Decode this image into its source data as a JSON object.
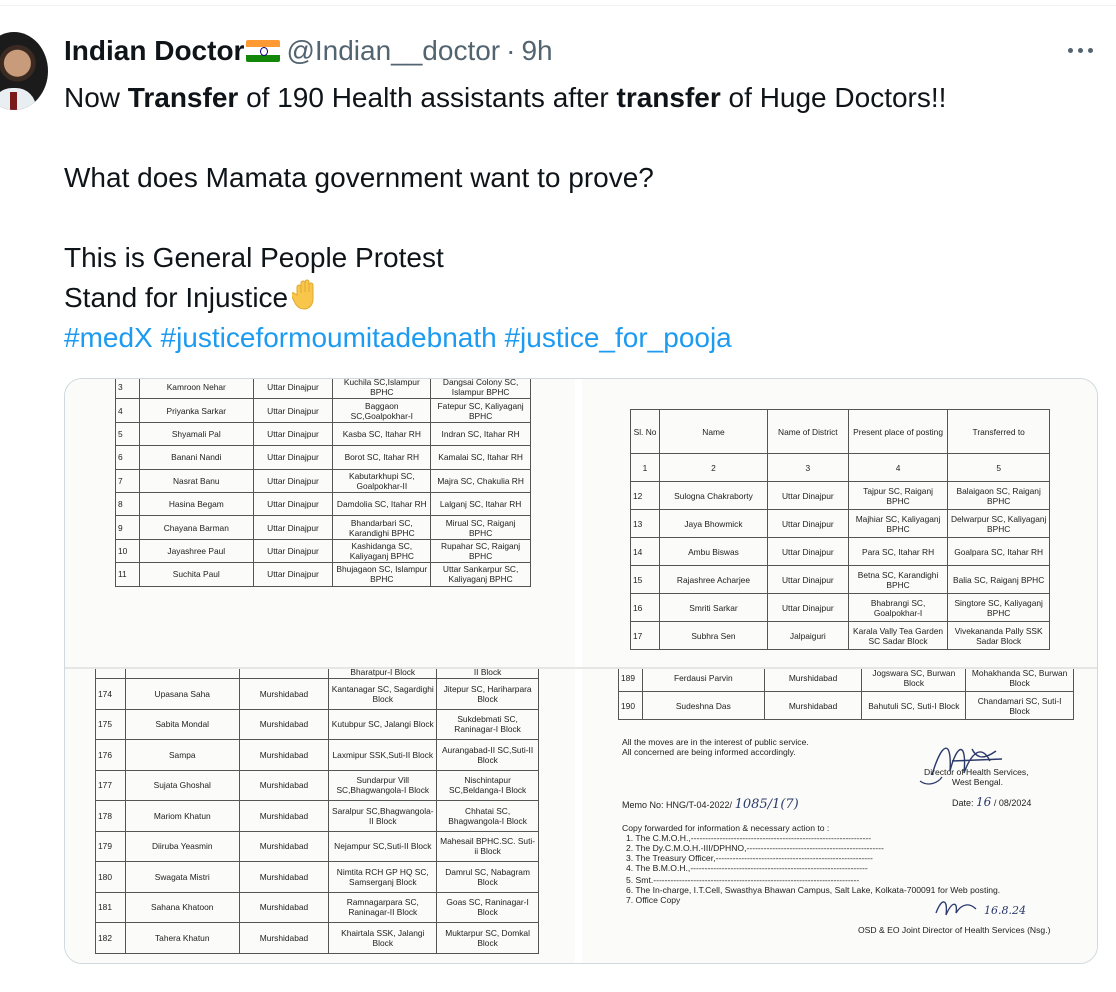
{
  "author": {
    "display_name": "Indian Doctor",
    "handle": "@Indian__doctor",
    "separator": "·",
    "time": "9h"
  },
  "icons": {
    "flag": "india-flag-icon",
    "more": "more-horizontal-icon",
    "hand": "raised-hand-icon"
  },
  "tweet": {
    "line1": {
      "a": "Now ",
      "b": "Transfer",
      "c": " of 190 Health  assistants after ",
      "d": "transfer",
      "e": " of Huge Doctors!!"
    },
    "line2": "What does Mamata government want to prove?",
    "line3": "This is General People Protest",
    "line4": "Stand for Injustice",
    "hashtags": [
      "#medX",
      "#justiceformoumitadebnath",
      "#justice_for_pooja"
    ]
  },
  "colors": {
    "link": "#1d9bf0",
    "text": "#0f1419",
    "muted": "#536471",
    "border": "#cfd9de"
  },
  "doc_top_left": {
    "rows": [
      [
        "3",
        "Kamroon Nehar",
        "Uttar Dinajpur",
        "Kuchila SC,Islampur BPHC",
        "Dangsai Colony SC, Islampur BPHC"
      ],
      [
        "4",
        "Priyanka Sarkar",
        "Uttar Dinajpur",
        "Baggaon SC,Goalpokhar-I",
        "Fatepur SC, Kaliyaganj BPHC"
      ],
      [
        "5",
        "Shyamali Pal",
        "Uttar Dinajpur",
        "Kasba SC, Itahar RH",
        "Indran SC, Itahar RH"
      ],
      [
        "6",
        "Banani Nandi",
        "Uttar Dinajpur",
        "Borot SC, Itahar RH",
        "Kamalai SC, Itahar RH"
      ],
      [
        "7",
        "Nasrat Banu",
        "Uttar Dinajpur",
        "Kabutarkhupi SC, Goalpokhar-II",
        "Majra SC, Chakulia RH"
      ],
      [
        "8",
        "Hasina Begam",
        "Uttar Dinajpur",
        "Damdolia SC, Itahar RH",
        "Lalganj SC, Itahar RH"
      ],
      [
        "9",
        "Chayana Barman",
        "Uttar Dinajpur",
        "Bhandarbari SC, Karandighi BPHC",
        "Mirual SC, Raiganj BPHC"
      ],
      [
        "10",
        "Jayashree Paul",
        "Uttar Dinajpur",
        "Kashidanga SC, Kaliyaganj BPHC",
        "Rupahar SC, Raiganj BPHC"
      ],
      [
        "11",
        "Suchita Paul",
        "Uttar Dinajpur",
        "Bhujagaon SC, Islampur BPHC",
        "Uttar Sankarpur SC, Kaliyaganj BPHC"
      ]
    ]
  },
  "doc_top_right": {
    "headers": [
      "Sl. No",
      "Name",
      "Name of District",
      "Present place of posting",
      "Transferred to"
    ],
    "col_numbers": [
      "1",
      "2",
      "3",
      "4",
      "5"
    ],
    "rows": [
      [
        "12",
        "Sulogna Chakraborty",
        "Uttar Dinajpur",
        "Tajpur SC, Raiganj BPHC",
        "Balaigaon SC, Raiganj BPHC"
      ],
      [
        "13",
        "Jaya Bhowmick",
        "Uttar Dinajpur",
        "Majhiar SC, Kaliyaganj BPHC",
        "Delwarpur SC, Kaliyaganj BPHC"
      ],
      [
        "14",
        "Ambu Biswas",
        "Uttar Dinajpur",
        "Para SC, Itahar RH",
        "Goalpara SC, Itahar RH"
      ],
      [
        "15",
        "Rajashree Acharjee",
        "Uttar Dinajpur",
        "Betna SC, Karandighi BPHC",
        "Balia SC, Raiganj BPHC"
      ],
      [
        "16",
        "Smriti Sarkar",
        "Uttar Dinajpur",
        "Bhabrangi SC, Goalpokhar-I",
        "Singtore SC, Kaliyaganj BPHC"
      ],
      [
        "17",
        "Subhra Sen",
        "Jalpaiguri",
        "Karala Vally Tea Garden SC Sadar Block",
        "Vivekananda Pally SSK Sadar Block"
      ]
    ]
  },
  "doc_bottom_left": {
    "top_partial": [
      "Bharatpur-I Block",
      "II Block"
    ],
    "rows": [
      [
        "174",
        "Upasana Saha",
        "Murshidabad",
        "Kantanagar SC, Sagardighi Block",
        "Jitepur SC, Hariharpara Block"
      ],
      [
        "175",
        "Sabita Mondal",
        "Murshidabad",
        "Kutubpur SC, Jalangi Block",
        "Sukdebmati SC, Raninagar-I Block"
      ],
      [
        "176",
        "Sampa",
        "Murshidabad",
        "Laxmipur SSK,Suti-II Block",
        "Aurangabad-II SC,Suti-II Block"
      ],
      [
        "177",
        "Sujata Ghoshal",
        "Murshidabad",
        "Sundarpur Vill SC,Bhagwangola-I Block",
        "Nischintapur SC,Beldanga-I Block"
      ],
      [
        "178",
        "Mariom Khatun",
        "Murshidabad",
        "Saralpur SC,Bhagwangola-II Block",
        "Chhatai SC, Bhagwangola-I Block"
      ],
      [
        "179",
        "Diiruba Yeasmin",
        "Murshidabad",
        "Nejampur SC,Suti-II Block",
        "Mahesail BPHC.SC. Suti-ii Block"
      ],
      [
        "180",
        "Swagata Mistri",
        "Murshidabad",
        "Nimtita RCH GP HQ SC, Samserganj Block",
        "Damrul SC, Nabagram Block"
      ],
      [
        "181",
        "Sahana Khatoon",
        "Murshidabad",
        "Ramnagarpara SC, Raninagar-II Block",
        "Goas SC, Raninagar-I Block"
      ],
      [
        "182",
        "Tahera Khatun",
        "Murshidabad",
        "Khairtala SSK, Jalangi Block",
        "Muktarpur SC, Domkal Block"
      ]
    ]
  },
  "doc_bottom_right": {
    "rows": [
      [
        "189",
        "Ferdausi Parvin",
        "Murshidabad",
        "Jogswara SC, Burwan Block",
        "Mohakhanda SC, Burwan Block"
      ],
      [
        "190",
        "Sudeshna Das",
        "Murshidabad",
        "Bahutuli SC, Suti-I Block",
        "Chandamari SC, Suti-I Block"
      ]
    ],
    "note1": "All the moves are in the interest of public service.",
    "note2": "All concerned are being informed accordingly.",
    "director1": "Director of Health Services,",
    "director2": "West Bengal.",
    "memo_label": "Memo No:",
    "memo_no": "HNG/T-04-2022/",
    "memo_hand": "1085/1(7)",
    "date_label": "Date:",
    "date_day": "16",
    "date_rest": "08/2024",
    "copy_heading": "Copy forwarded for information & necessary action to :",
    "copy_list": [
      "1.  The C.M.O.H.,---------------------------------------------------------------",
      "2.  The Dy.C.M.O.H.-III/DPHNO,------------------------------------------------",
      "3.  The Treasury Officer,-------------------------------------------------------",
      "4.  The B.M.O.H.,--------------------------------------------------------------",
      "5.  Smt.------------------------------------------------------------------------",
      "6.  The In-charge, I.T.Cell, Swasthya Bhawan Campus, Salt Lake, Kolkata-700091 for Web posting.",
      "7.  Office Copy"
    ],
    "sign_date": "16.8.24",
    "osd": "OSD & EO Joint Director of Health Services (Nsg.)"
  }
}
